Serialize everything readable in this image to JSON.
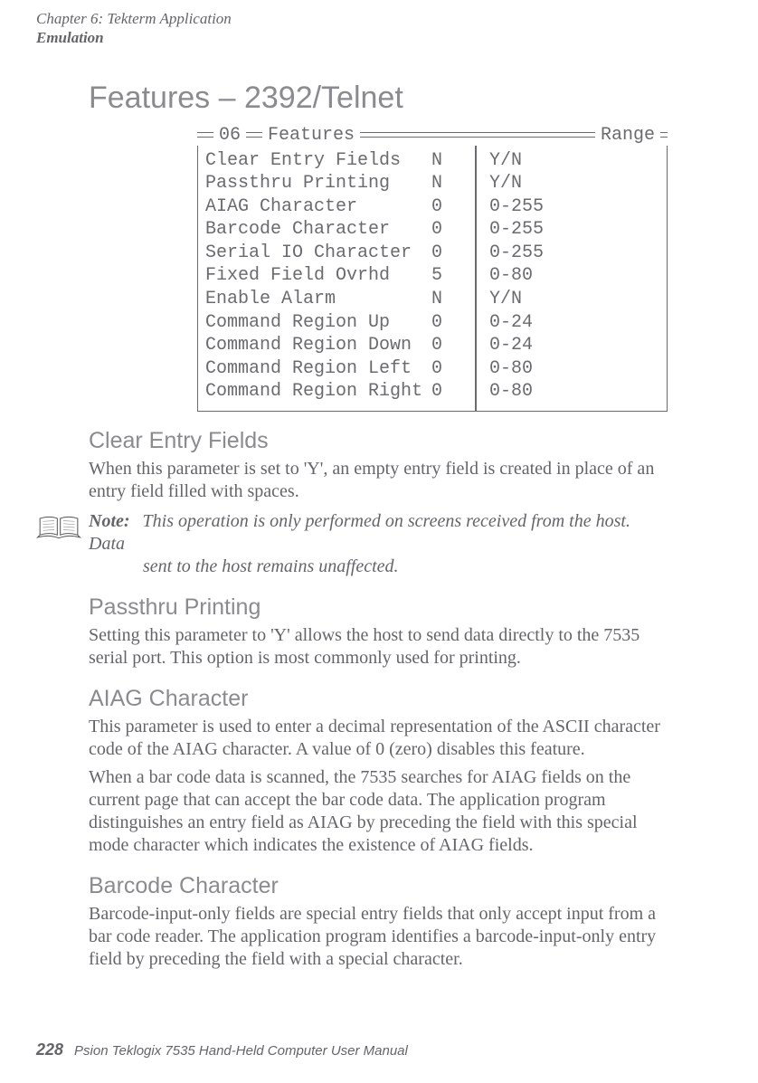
{
  "header": {
    "chapter": "Chapter 6: Tekterm Application",
    "section": "Emulation"
  },
  "section_title": "Features – 2392/Telnet",
  "features_box": {
    "number": "06",
    "title": "Features",
    "range_label": "Range",
    "rows": [
      {
        "label": "Clear Entry Fields",
        "value": "N",
        "range": "Y/N"
      },
      {
        "label": "Passthru Printing",
        "value": "N",
        "range": "Y/N"
      },
      {
        "label": "AIAG Character",
        "value": "0",
        "range": "0-255"
      },
      {
        "label": "Barcode Character",
        "value": "0",
        "range": "0-255"
      },
      {
        "label": "Serial IO Character",
        "value": "0",
        "range": "0-255"
      },
      {
        "label": "Fixed Field Ovrhd",
        "value": "5",
        "range": "0-80"
      },
      {
        "label": "Enable Alarm",
        "value": "N",
        "range": "Y/N"
      },
      {
        "label": "Command Region Up",
        "value": "0",
        "range": "0-24"
      },
      {
        "label": "Command Region Down",
        "value": "0",
        "range": "0-24"
      },
      {
        "label": "Command Region Left",
        "value": "0",
        "range": "0-80"
      },
      {
        "label": "Command Region Right",
        "value": "0",
        "range": "0-80"
      }
    ]
  },
  "sections": {
    "clear_entry_fields": {
      "title": "Clear Entry Fields",
      "body": "When this parameter is set to 'Y', an empty entry field is created in place of an entry field filled with spaces."
    },
    "note": {
      "label": "Note:",
      "body_line1": "This operation is only performed on screens received from the host. Data",
      "body_line2": "sent to the host remains unaffected."
    },
    "passthru_printing": {
      "title": "Passthru Printing",
      "body": "Setting this parameter to 'Y' allows the host to send data directly to the 7535 serial port. This option is most commonly used for printing."
    },
    "aiag_character": {
      "title": "AIAG Character",
      "body1": "This parameter is used to enter a decimal representation of the ASCII character code of the AIAG character. A value of 0 (zero) disables this feature.",
      "body2": "When a bar code data is scanned, the 7535 searches for AIAG fields on the current page that can accept the bar code data. The application program distinguishes an entry field as AIAG by preceding the field with this special mode character which indicates the existence of AIAG fields."
    },
    "barcode_character": {
      "title": "Barcode Character",
      "body": "Barcode-input-only fields are special entry fields that only accept input from a bar code reader. The application program identifies a barcode-input-only entry field by preceding the field with a special character."
    }
  },
  "footer": {
    "page_number": "228",
    "manual": "Psion Teklogix 7535 Hand-Held Computer User Manual"
  }
}
